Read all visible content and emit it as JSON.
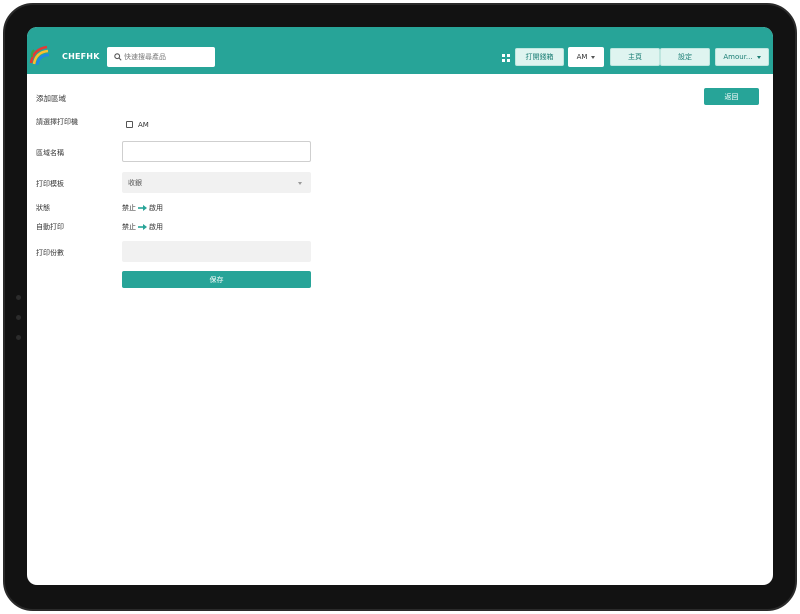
{
  "header": {
    "brand": "CHEFHK",
    "search_placeholder": "快速搜尋產品",
    "open_drawer_label": "打開錢箱",
    "printer_selector": "AM",
    "home_label": "主頁",
    "settings_label": "設定",
    "user_menu_label": "Amour..."
  },
  "page": {
    "title": "添加區域",
    "return_label": "返回"
  },
  "form": {
    "printer_label": "請選擇打印機",
    "printer_option": "AM",
    "area_name_label": "區域名稱",
    "area_name_value": "",
    "template_label": "打印模板",
    "template_value": "收銀",
    "status_label": "狀態",
    "status_off": "禁止",
    "status_on": "啟用",
    "auto_print_label": "自動打印",
    "auto_print_off": "禁止",
    "auto_print_on": "啟用",
    "copies_label": "打印份數",
    "copies_value": "",
    "save_label": "保存"
  },
  "colors": {
    "accent": "#27a498",
    "button_light": "#dff4f0"
  }
}
